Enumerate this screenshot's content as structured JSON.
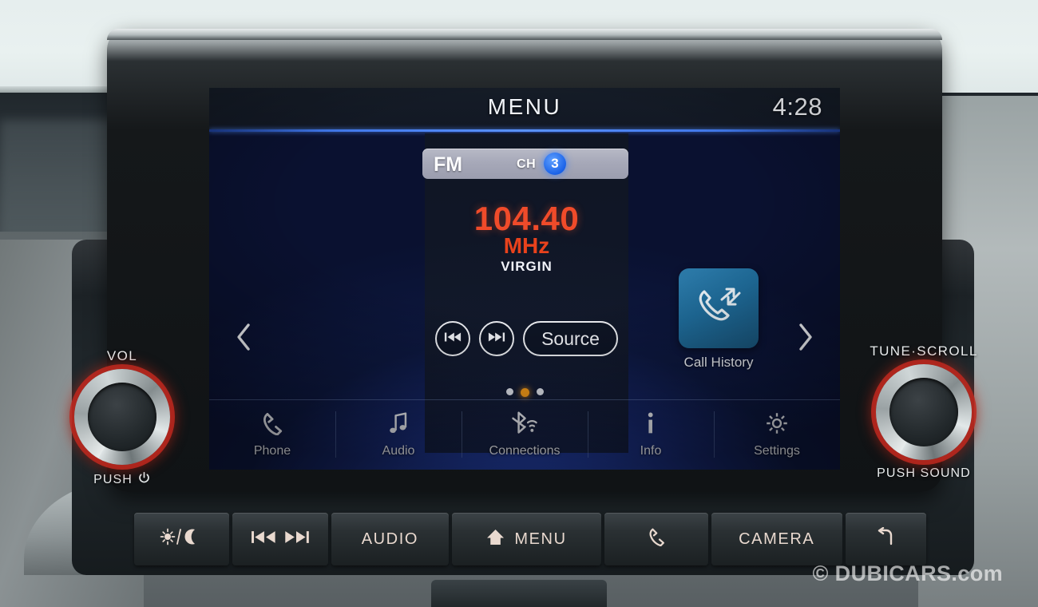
{
  "screen": {
    "title": "MENU",
    "clock": "4:28",
    "radio": {
      "band": "FM",
      "ch_label": "CH",
      "ch_number": "3",
      "frequency": "104.40",
      "unit": "MHz",
      "station": "VIRGIN",
      "prev_icon": "skip-previous-icon",
      "next_icon": "skip-next-icon",
      "source_label": "Source"
    },
    "nav_arrows": {
      "prev_icon": "chevron-left-icon",
      "next_icon": "chevron-right-icon"
    },
    "tile": {
      "label": "Call History",
      "icon": "call-history-icon"
    },
    "page_dots": {
      "count": 3,
      "active_index": 1
    },
    "bottom_nav": [
      {
        "label": "Phone",
        "icon": "phone-icon"
      },
      {
        "label": "Audio",
        "icon": "music-note-icon"
      },
      {
        "label": "Connections",
        "icon": "bluetooth-wifi-icon"
      },
      {
        "label": "Info",
        "icon": "info-icon"
      },
      {
        "label": "Settings",
        "icon": "gear-icon"
      }
    ]
  },
  "knobs": {
    "left": {
      "top_label": "VOL",
      "bottom_label": "PUSH",
      "bottom_icon": "power-icon"
    },
    "right": {
      "top_label": "TUNE·SCROLL",
      "bottom_label": "PUSH SOUND",
      "bottom_icon": ""
    }
  },
  "hard_buttons": [
    {
      "label": "",
      "icon": "display-day-night-icon"
    },
    {
      "label": "",
      "icon": "track-prev-next-icon"
    },
    {
      "label": "AUDIO",
      "icon": ""
    },
    {
      "label": "MENU",
      "icon": "home-icon"
    },
    {
      "label": "",
      "icon": "phone-icon"
    },
    {
      "label": "CAMERA",
      "icon": ""
    },
    {
      "label": "",
      "icon": "back-arrow-icon"
    }
  ],
  "watermark": "© DUBICARS.com",
  "colors": {
    "accent_orange": "#f04b2a",
    "accent_blue": "#3f76e8",
    "tile_blue": "#1f6d9c",
    "knob_ring_red": "#be281e"
  }
}
